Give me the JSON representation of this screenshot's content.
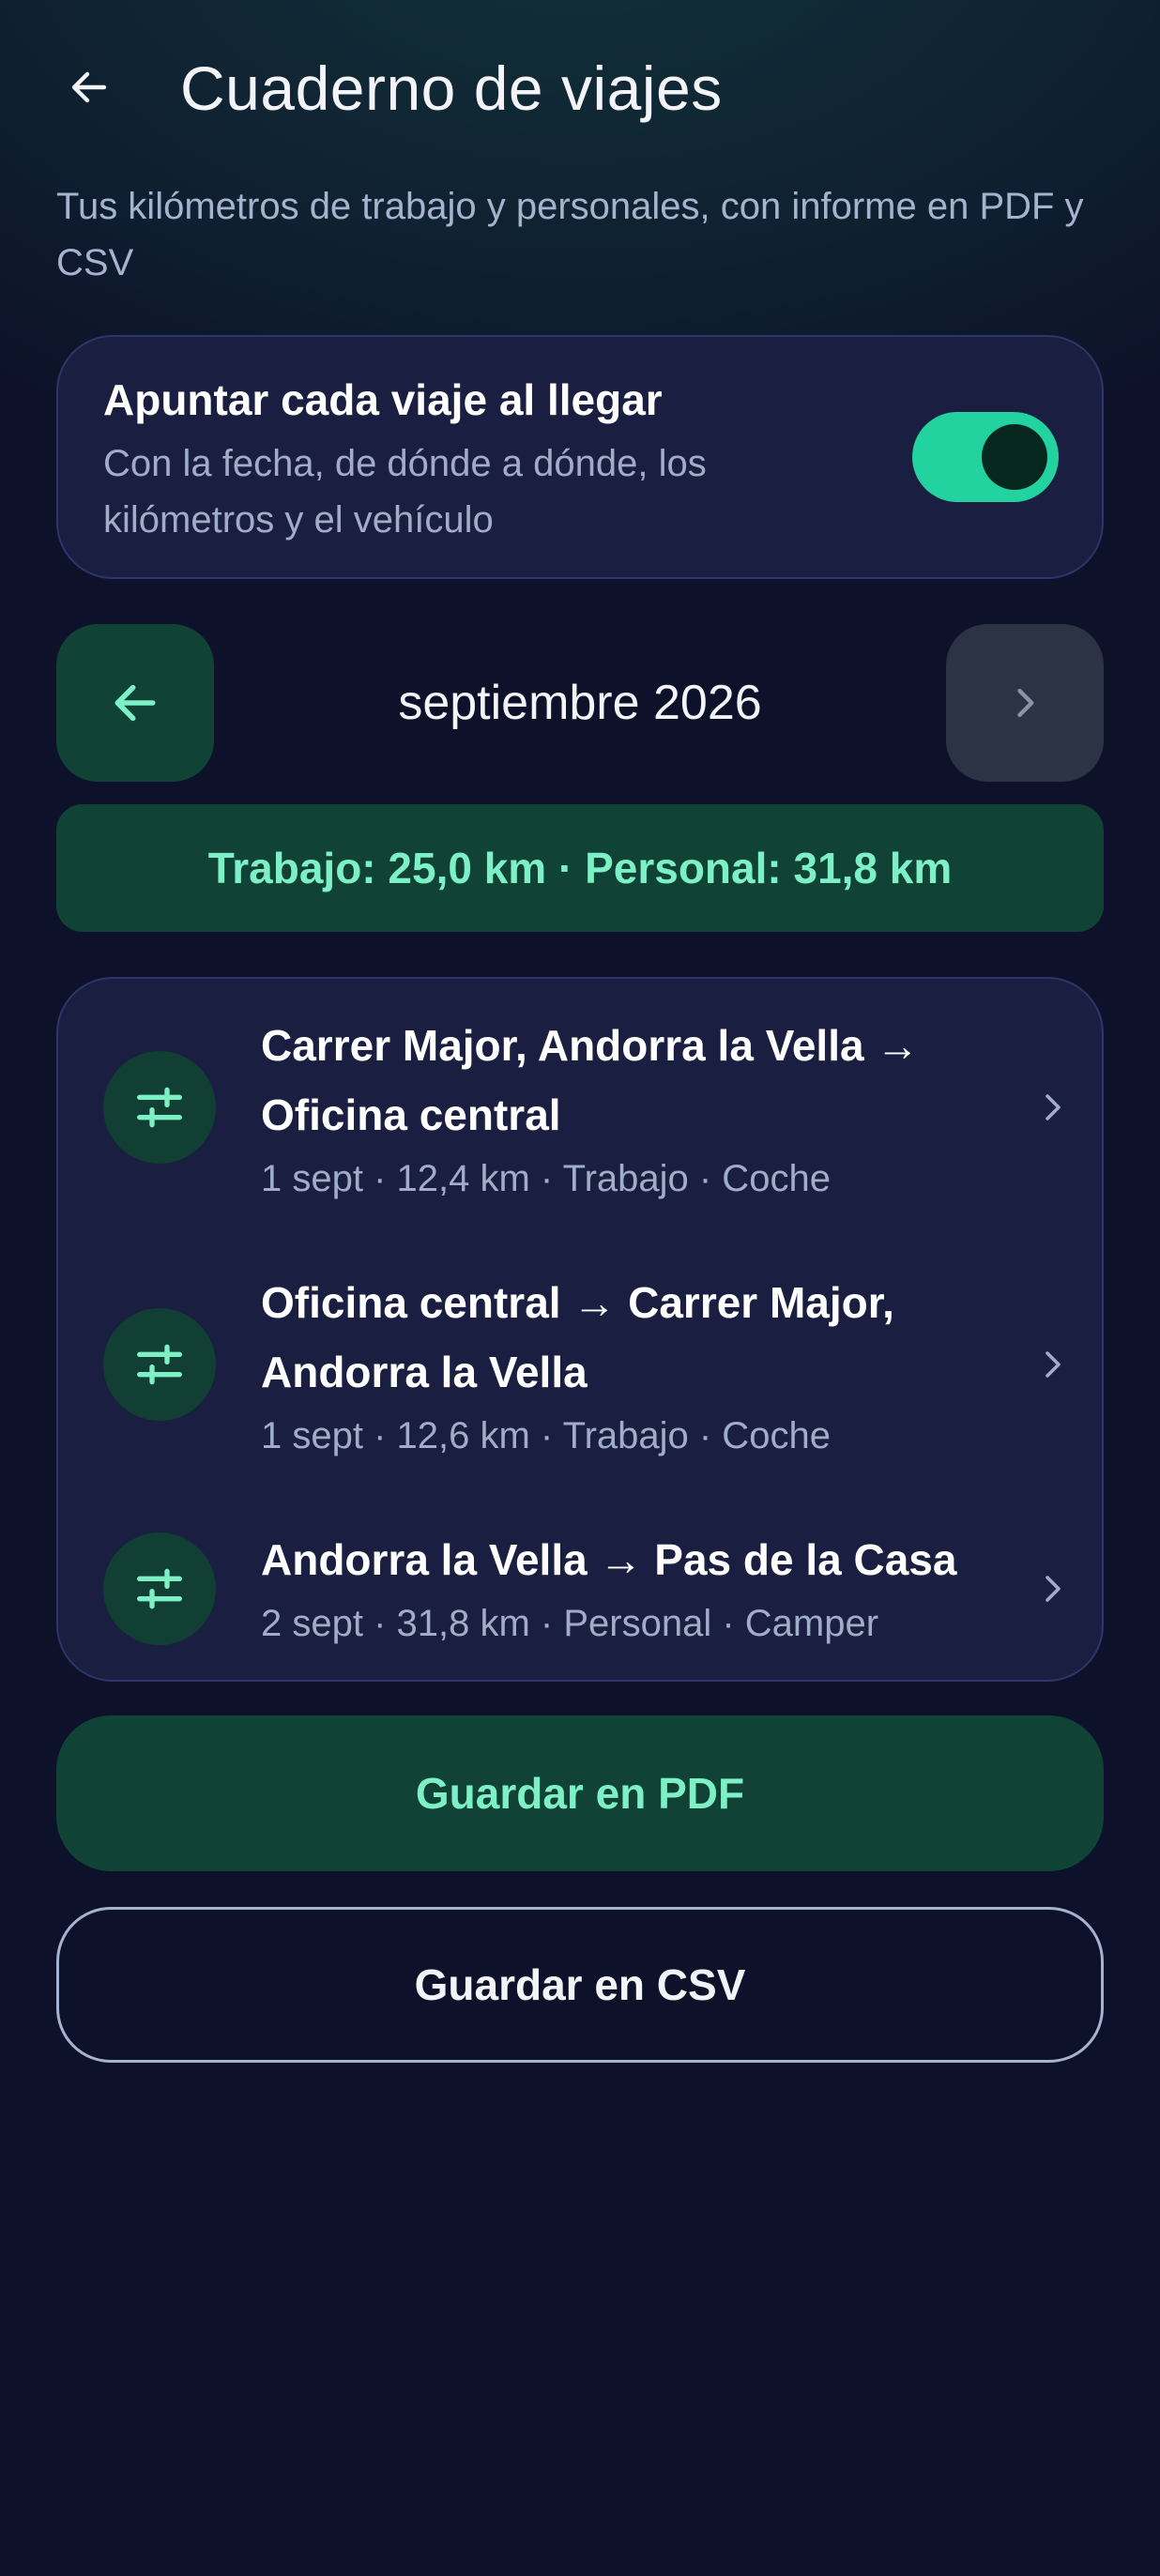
{
  "header": {
    "back_icon": "arrow-left-icon",
    "title": "Cuaderno de viajes",
    "subtitle": "Tus kilómetros de trabajo y personales, con informe en PDF y CSV"
  },
  "auto_log": {
    "title": "Apuntar cada viaje al llegar",
    "description": "Con la fecha, de dónde a dónde, los kilómetros y el vehículo",
    "enabled": true
  },
  "month_nav": {
    "prev_icon": "arrow-left-icon",
    "label": "septiembre 2026",
    "next_icon": "chevron-right-icon"
  },
  "summary": {
    "text": "Trabajo: 25,0 km · Personal: 31,8 km"
  },
  "trips": [
    {
      "icon": "sliders-icon",
      "title": "Carrer Major, Andorra la Vella → Oficina central",
      "meta": "1 sept · 12,4 km · Trabajo · Coche"
    },
    {
      "icon": "sliders-icon",
      "title": "Oficina central → Carrer Major, Andorra la Vella",
      "meta": "1 sept · 12,6 km · Trabajo · Coche"
    },
    {
      "icon": "sliders-icon",
      "title": "Andorra la Vella → Pas de la Casa",
      "meta": "2 sept · 31,8 km · Personal · Camper"
    }
  ],
  "actions": {
    "pdf_label": "Guardar en PDF",
    "csv_label": "Guardar en CSV"
  },
  "colors": {
    "accent": "#22d3a0",
    "accent_text": "#7ef0c6",
    "accent_surface": "#114236",
    "card_surface": "#1a1f42",
    "background": "#0d1129"
  }
}
